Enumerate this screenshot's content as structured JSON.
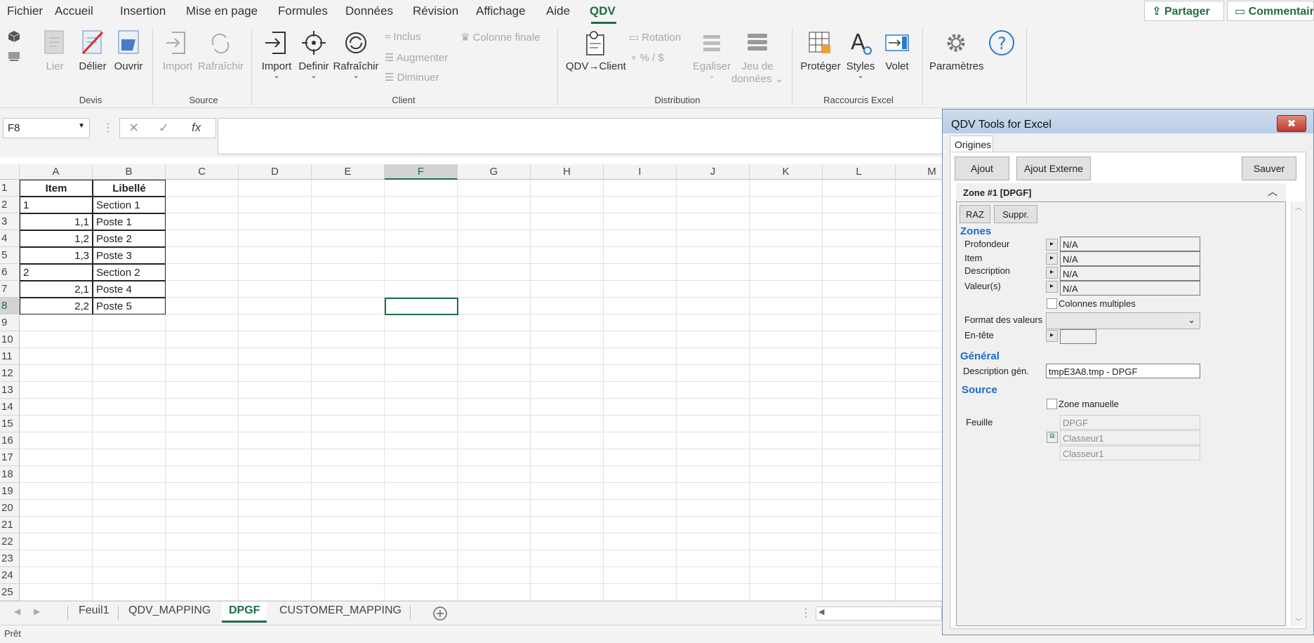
{
  "menu": {
    "tabs": [
      "Fichier",
      "Accueil",
      "Insertion",
      "Mise en page",
      "Formules",
      "Données",
      "Révision",
      "Affichage",
      "Aide",
      "QDV"
    ],
    "active_tab": "QDV",
    "share_label": "Partager",
    "comments_label": "Commentair"
  },
  "ribbon": {
    "devis": {
      "group": "Devis",
      "lier": "Lier",
      "delier": "Délier",
      "ouvrir": "Ouvrir"
    },
    "source": {
      "group": "Source",
      "import": "Import",
      "rafraichir": "Rafraîchir"
    },
    "client": {
      "group": "Client",
      "import": "Import",
      "definir": "Definir",
      "rafraichir": "Rafraîchir",
      "inclus": "Inclus",
      "augmenter": "Augmenter",
      "diminuer": "Diminuer",
      "colonne_finale": "Colonne finale"
    },
    "distribution": {
      "group": "Distribution",
      "qdv_client": "QDV→Client",
      "rotation": "Rotation",
      "percent": "% / $",
      "egaliser": "Egaliser",
      "jeu1": "Jeu de",
      "jeu2": "données"
    },
    "raccourcis": {
      "group": "Raccourcis Excel",
      "proteger": "Protéger",
      "styles": "Styles",
      "volet": "Volet"
    },
    "parametres": "Paramètres"
  },
  "formula": {
    "name_box": "F8",
    "fx": "fx",
    "value": ""
  },
  "grid": {
    "columns": [
      "A",
      "B",
      "C",
      "D",
      "E",
      "F",
      "G",
      "H",
      "I",
      "J",
      "K",
      "L",
      "M"
    ],
    "selected_column": "F",
    "rows": [
      "1",
      "2",
      "3",
      "4",
      "5",
      "6",
      "7",
      "8",
      "9",
      "10",
      "11",
      "12",
      "13",
      "14",
      "15",
      "16",
      "17",
      "18",
      "19",
      "20",
      "21",
      "22",
      "23",
      "24",
      "25"
    ],
    "selected_row": "8",
    "table": [
      {
        "a": "Item",
        "b": "Libellé",
        "header": true
      },
      {
        "a": "1",
        "b": "Section 1",
        "num": false
      },
      {
        "a": "1,1",
        "b": "Poste 1",
        "num": true
      },
      {
        "a": "1,2",
        "b": "Poste 2",
        "num": true
      },
      {
        "a": "1,3",
        "b": "Poste 3",
        "num": true
      },
      {
        "a": "2",
        "b": "Section 2",
        "num": false
      },
      {
        "a": "2,1",
        "b": "Poste 4",
        "num": true
      },
      {
        "a": "2,2",
        "b": "Poste 5",
        "num": true
      }
    ]
  },
  "sheets": {
    "tabs": [
      "Feuil1",
      "QDV_MAPPING",
      "DPGF",
      "CUSTOMER_MAPPING"
    ],
    "active": "DPGF"
  },
  "status": {
    "text": "Prêt"
  },
  "pane": {
    "title": "QDV Tools for Excel",
    "close": "✖",
    "tab": "Origines",
    "ajout": "Ajout",
    "ajout_externe": "Ajout Externe",
    "sauver": "Sauver",
    "zone_title": "Zone #1 [DPGF]",
    "raz": "RAZ",
    "suppr": "Suppr.",
    "zones_header": "Zones",
    "profondeur": "Profondeur",
    "item": "Item",
    "description": "Description",
    "valeurs": "Valeur(s)",
    "na": "N/A",
    "colonnes_multiples": "Colonnes multiples",
    "format_valeurs": "Format des valeurs",
    "en_tete": "En-tête",
    "general_header": "Général",
    "description_gen": "Description gén.",
    "description_gen_value": "tmpE3A8.tmp - DPGF",
    "source_header": "Source",
    "zone_manuelle": "Zone manuelle",
    "feuille": "Feuille",
    "feuille_values": [
      "DPGF",
      "Classeur1",
      "Classeur1"
    ]
  },
  "colors": {
    "accent": "#1e6e43",
    "section": "#1c6bc6",
    "close": "#c0392b"
  }
}
